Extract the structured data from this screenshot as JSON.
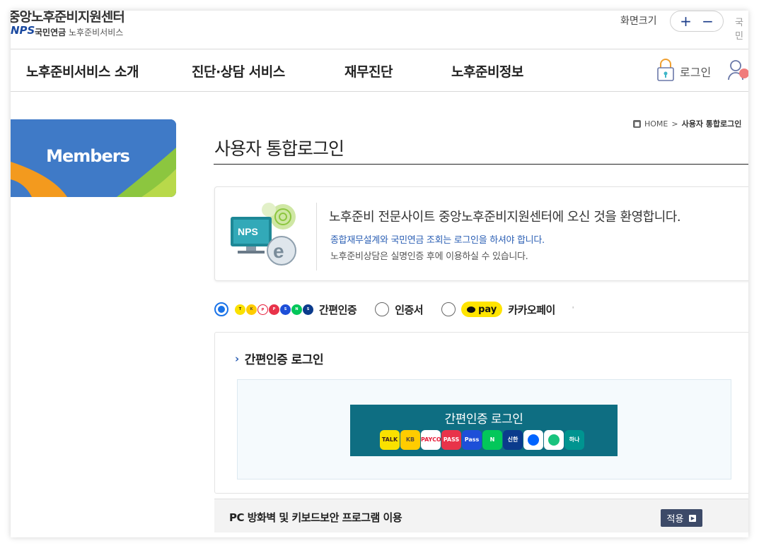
{
  "header": {
    "logo_title": "중앙노후준비지원센터",
    "logo_brand": "NPS",
    "logo_org": "국민연금",
    "logo_service": "노후준비서비스",
    "zoom_label": "화면크기",
    "zoom_in": "+",
    "zoom_out": "−",
    "lang": "국민"
  },
  "nav": {
    "items": [
      {
        "label": "노후준비서비스 소개"
      },
      {
        "label": "진단·상담 서비스"
      },
      {
        "label": "재무진단"
      },
      {
        "label": "노후준비정보"
      }
    ],
    "login_label": "로그인"
  },
  "side": {
    "banner_title": "Members",
    "colors": {
      "blue": "#3f7ac7",
      "orange": "#f39a1e",
      "green": "#8cc63f"
    }
  },
  "breadcrumb": {
    "home": "HOME",
    "separator": ">",
    "current": "사용자 통합로그인"
  },
  "page": {
    "title": "사용자 통합로그인"
  },
  "welcome": {
    "logo_text": "NPS",
    "title": "노후준비 전문사이트 중앙노후준비지원센터에 오신 것을 환영합니다.",
    "line1": "종합재무설계와 국민연금 조회는 로그인을 하셔야 합니다.",
    "line2": "노후준비상담은 실명인증 후에 이용하실 수 있습니다."
  },
  "auth": {
    "options": [
      {
        "label": "간편인증",
        "selected": true
      },
      {
        "label": "인증서",
        "selected": false
      },
      {
        "label": "카카오페이",
        "selected": false
      }
    ],
    "kakaopay_badge": "pay",
    "tail": "'"
  },
  "panel": {
    "title": "간편인증 로그인",
    "button_label": "간편인증 로그인",
    "provider_icons": [
      {
        "name": "kakaotalk-icon",
        "text": "TALK",
        "color": "#fae100",
        "fg": "#3b1e1e"
      },
      {
        "name": "kb-icon",
        "text": "KB",
        "color": "#ffcc00",
        "fg": "#5a4b3c"
      },
      {
        "name": "payco-icon",
        "text": "PAYCO",
        "color": "#ffffff",
        "fg": "#e51937"
      },
      {
        "name": "pass-icon",
        "text": "PASS",
        "color": "#e8334a",
        "fg": "#ffffff"
      },
      {
        "name": "samsung-pass-icon",
        "text": "Pass",
        "color": "#1d4fd8",
        "fg": "#ffffff"
      },
      {
        "name": "naver-icon",
        "text": "N",
        "color": "#03c75a",
        "fg": "#ffffff"
      },
      {
        "name": "shinhan-icon",
        "text": "신한",
        "color": "#0b3b8c",
        "fg": "#ffffff"
      },
      {
        "name": "toss-icon",
        "text": "",
        "color": "#ffffff",
        "fg": "#0064ff"
      },
      {
        "name": "banksalad-icon",
        "text": "",
        "color": "#ffffff",
        "fg": "#19c37d"
      },
      {
        "name": "hana-icon",
        "text": "하나",
        "color": "#009490",
        "fg": "#ffffff"
      }
    ]
  },
  "bottom": {
    "text": "PC 방화벽 및 키보드보안 프로그램 이용",
    "apply_label": "적용"
  }
}
